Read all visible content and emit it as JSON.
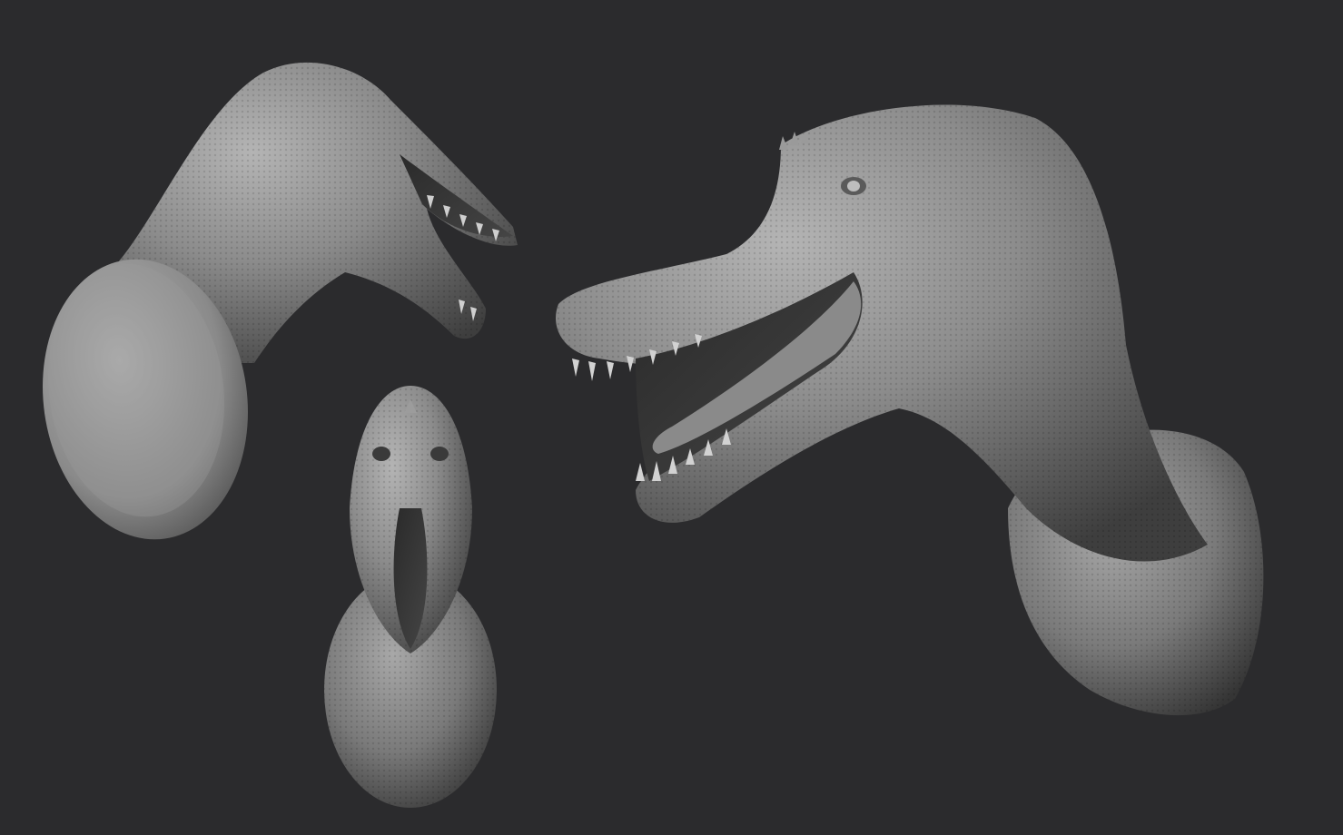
{
  "scene": {
    "background_color": "#2b2b2d",
    "clay_color": "#8f8f8f",
    "views": [
      {
        "id": "side-view-left",
        "icon": "dinosaur-head-side-icon"
      },
      {
        "id": "front-view",
        "icon": "dinosaur-head-front-icon"
      },
      {
        "id": "three-quarter-view",
        "icon": "dinosaur-head-three-quarter-icon"
      }
    ]
  }
}
